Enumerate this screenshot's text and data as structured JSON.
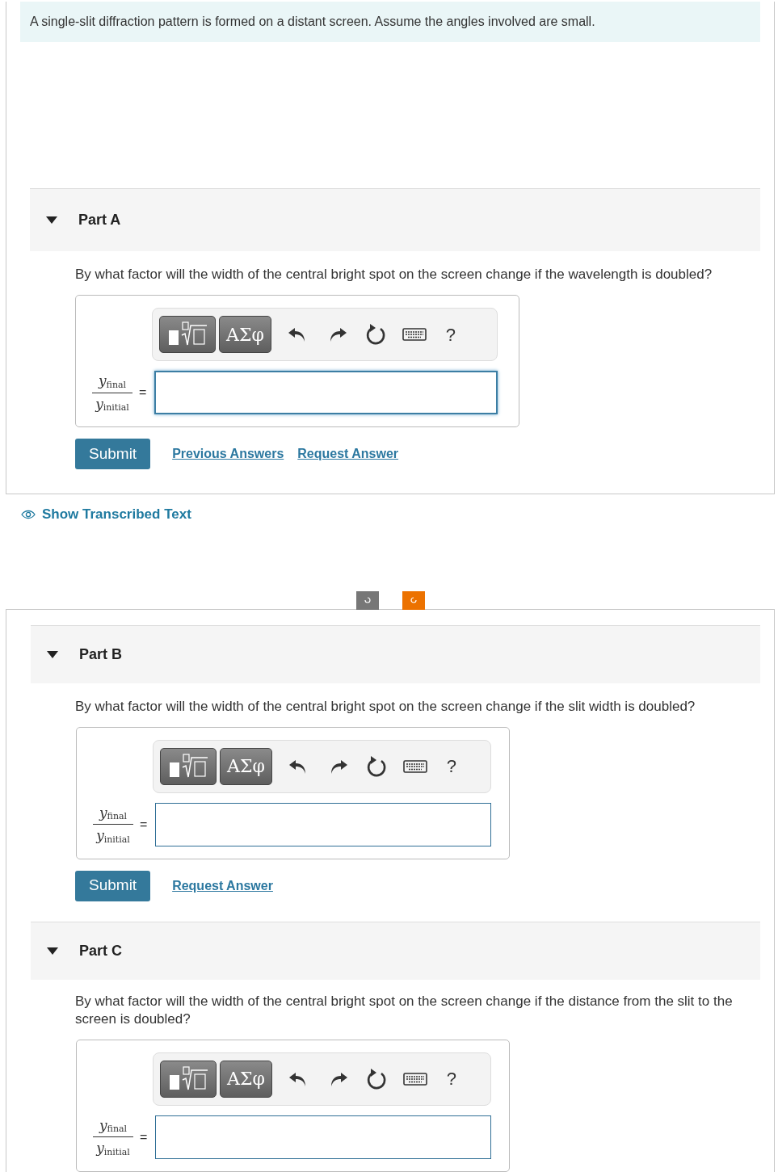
{
  "intro": "A single-slit diffraction pattern is formed on a distant screen. Assume the angles involved are small.",
  "top_parts": [
    {
      "title": "Part A",
      "expanded": true,
      "question": "By what factor will the width of the central bright spot on the screen change if the wavelength is doubled?",
      "numerator": "y",
      "numerator_sub": "final",
      "denominator": "y",
      "denominator_sub": "initial",
      "equals": "=",
      "symbols_label": "ΑΣφ",
      "help_label": "?",
      "focused": true,
      "submit": "Submit",
      "links": [
        "Previous Answers",
        "Request Answer"
      ]
    }
  ],
  "transcribed_link": "Show Transcribed Text",
  "bottom_parts": [
    {
      "title": "Part B",
      "expanded": true,
      "question": "By what factor will the width of the central bright spot on the screen change if the slit width is doubled?",
      "numerator": "y",
      "numerator_sub": "final",
      "denominator": "y",
      "denominator_sub": "initial",
      "equals": "=",
      "symbols_label": "ΑΣφ",
      "help_label": "?",
      "focused": false,
      "submit": "Submit",
      "links": [
        "Request Answer"
      ]
    },
    {
      "title": "Part C",
      "expanded": true,
      "question": "By what factor will the width of the central bright spot on the screen change if the distance from the slit to the screen is doubled?",
      "numerator": "y",
      "numerator_sub": "final",
      "denominator": "y",
      "denominator_sub": "initial",
      "equals": "=",
      "symbols_label": "ΑΣφ",
      "help_label": "?",
      "focused": false
    }
  ]
}
